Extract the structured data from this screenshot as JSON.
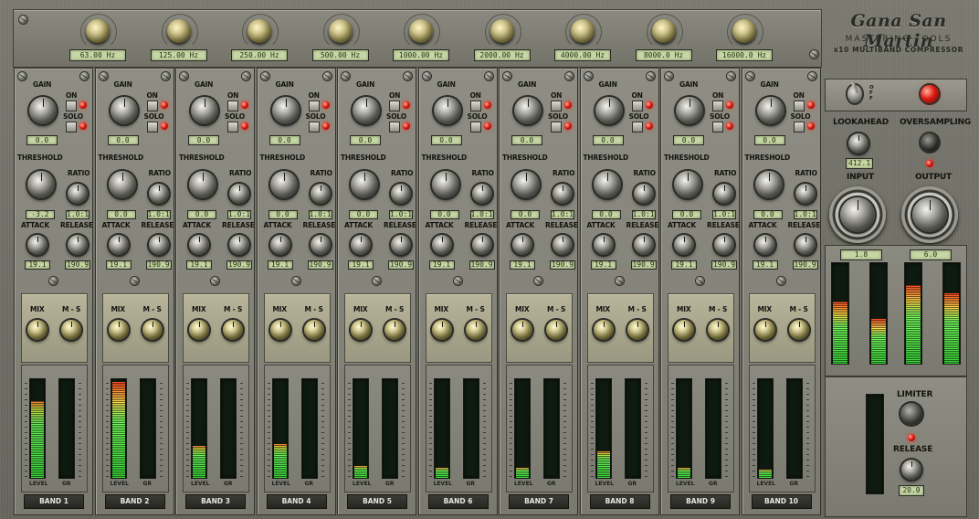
{
  "brand": {
    "title": "Gana San Martin",
    "subtitle": "MASTERING TOOLS",
    "model": "x10 MULTIBAND COMPRESSOR"
  },
  "frequencies": [
    "63.00 Hz",
    "125.00 Hz",
    "250.00 Hz",
    "500.00 Hz",
    "1000.00 Hz",
    "2000.00 Hz",
    "4000.00 Hz",
    "8000.0 Hz",
    "16000.0 Hz"
  ],
  "labels": {
    "gain": "GAIN",
    "on": "ON",
    "solo": "SOLO",
    "threshold": "THRESHOLD",
    "ratio": "RATIO",
    "attack": "ATTACK",
    "release": "RELEASE",
    "mix": "MIX",
    "ms": "M - S",
    "level": "LEVEL",
    "gr": "GR"
  },
  "bands": [
    {
      "name": "BAND 1",
      "gain": "0.0",
      "threshold": "-3.2",
      "ratio": "1.0:1",
      "attack": "19.1",
      "release": "190.9",
      "level": 0.78,
      "level_hot": false,
      "gr": 0.0
    },
    {
      "name": "BAND 2",
      "gain": "0.0",
      "threshold": "0.0",
      "ratio": "1.0:1",
      "attack": "19.1",
      "release": "190.9",
      "level": 0.97,
      "level_hot": true,
      "gr": 0.0
    },
    {
      "name": "BAND 3",
      "gain": "0.0",
      "threshold": "0.0",
      "ratio": "1.0:1",
      "attack": "19.1",
      "release": "190.9",
      "level": 0.32,
      "level_hot": false,
      "gr": 0.0
    },
    {
      "name": "BAND 4",
      "gain": "0.0",
      "threshold": "0.0",
      "ratio": "1.0:1",
      "attack": "19.1",
      "release": "190.9",
      "level": 0.34,
      "level_hot": false,
      "gr": 0.0
    },
    {
      "name": "BAND 5",
      "gain": "0.0",
      "threshold": "0.0",
      "ratio": "1.0:1",
      "attack": "19.1",
      "release": "190.9",
      "level": 0.12,
      "level_hot": false,
      "gr": 0.0
    },
    {
      "name": "BAND 6",
      "gain": "0.0",
      "threshold": "0.0",
      "ratio": "1.0:1",
      "attack": "19.1",
      "release": "190.9",
      "level": 0.1,
      "level_hot": false,
      "gr": 0.0
    },
    {
      "name": "BAND 7",
      "gain": "0.0",
      "threshold": "0.0",
      "ratio": "1.0:1",
      "attack": "19.1",
      "release": "190.9",
      "level": 0.1,
      "level_hot": false,
      "gr": 0.0
    },
    {
      "name": "BAND 8",
      "gain": "0.0",
      "threshold": "0.0",
      "ratio": "1.0:1",
      "attack": "19.1",
      "release": "190.9",
      "level": 0.27,
      "level_hot": false,
      "gr": 0.0
    },
    {
      "name": "BAND 9",
      "gain": "0.0",
      "threshold": "0.0",
      "ratio": "1.0:1",
      "attack": "19.1",
      "release": "190.9",
      "level": 0.1,
      "level_hot": false,
      "gr": 0.0
    },
    {
      "name": "BAND 10",
      "gain": "0.0",
      "threshold": "0.0",
      "ratio": "1.0:1",
      "attack": "19.1",
      "release": "190.9",
      "level": 0.08,
      "level_hot": false,
      "gr": 0.0
    }
  ],
  "master": {
    "power_label": "OFF",
    "lookahead_label": "LOOKAHEAD",
    "lookahead_value": "412.1",
    "oversampling_label": "OVERSAMPLING",
    "input_label": "INPUT",
    "input_value": "1.8",
    "output_label": "OUTPUT",
    "output_value": "6.0",
    "input_levels": [
      0.62,
      0.45
    ],
    "output_levels": [
      0.78,
      0.7
    ],
    "limiter_label": "LIMITER",
    "release_label": "RELEASE",
    "release_value": "20.0",
    "limiter_level": 0.0
  },
  "colors": {
    "led_red": "#e01a10",
    "lcd_bg": "#c6d7a4",
    "meter_green": "#3ad83a"
  }
}
